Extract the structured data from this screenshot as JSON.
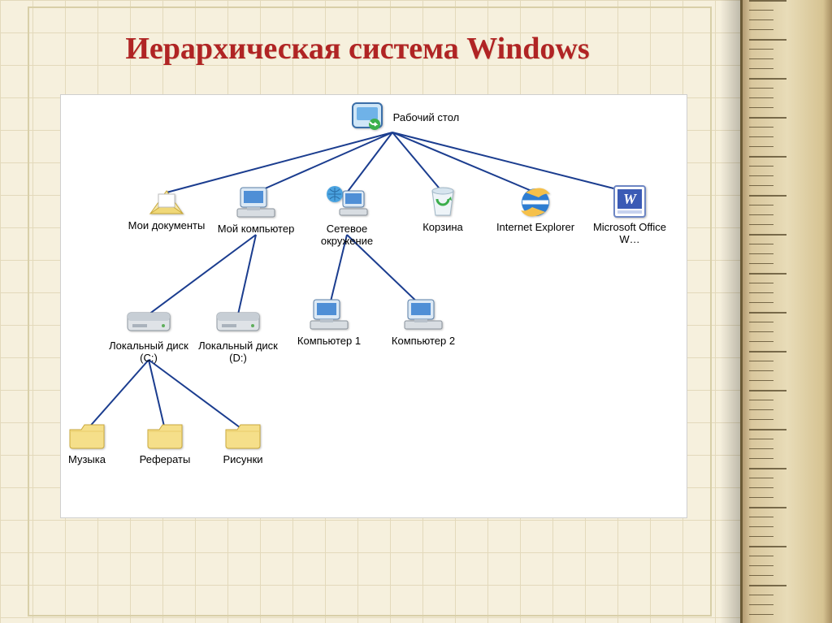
{
  "title": "Иерархическая система Windows",
  "nodes": {
    "desktop": {
      "label": "Рабочий стол"
    },
    "my_documents": {
      "label": "Мои документы"
    },
    "my_computer": {
      "label": "Мой компьютер"
    },
    "network": {
      "label": "Сетевое окружение"
    },
    "recycle_bin": {
      "label": "Корзина"
    },
    "ie": {
      "label": "Internet Explorer"
    },
    "ms_word": {
      "label": "Microsoft Office W…"
    },
    "disk_c": {
      "label": "Локальный диск (C:)"
    },
    "disk_d": {
      "label": "Локальный диск (D:)"
    },
    "computer1": {
      "label": "Компьютер 1"
    },
    "computer2": {
      "label": "Компьютер 2"
    },
    "music": {
      "label": "Музыка"
    },
    "essays": {
      "label": "Рефераты"
    },
    "pictures": {
      "label": "Рисунки"
    }
  },
  "edges": [
    [
      "desktop",
      "my_documents"
    ],
    [
      "desktop",
      "my_computer"
    ],
    [
      "desktop",
      "network"
    ],
    [
      "desktop",
      "recycle_bin"
    ],
    [
      "desktop",
      "ie"
    ],
    [
      "desktop",
      "ms_word"
    ],
    [
      "my_computer",
      "disk_c"
    ],
    [
      "my_computer",
      "disk_d"
    ],
    [
      "network",
      "computer1"
    ],
    [
      "network",
      "computer2"
    ],
    [
      "disk_c",
      "music"
    ],
    [
      "disk_c",
      "essays"
    ],
    [
      "disk_c",
      "pictures"
    ]
  ],
  "colors": {
    "title": "#b02424",
    "background": "#f6f0dd",
    "grid": "#e3d9bb",
    "diagram_bg": "#ffffff",
    "connector": "#1b3d8f"
  }
}
